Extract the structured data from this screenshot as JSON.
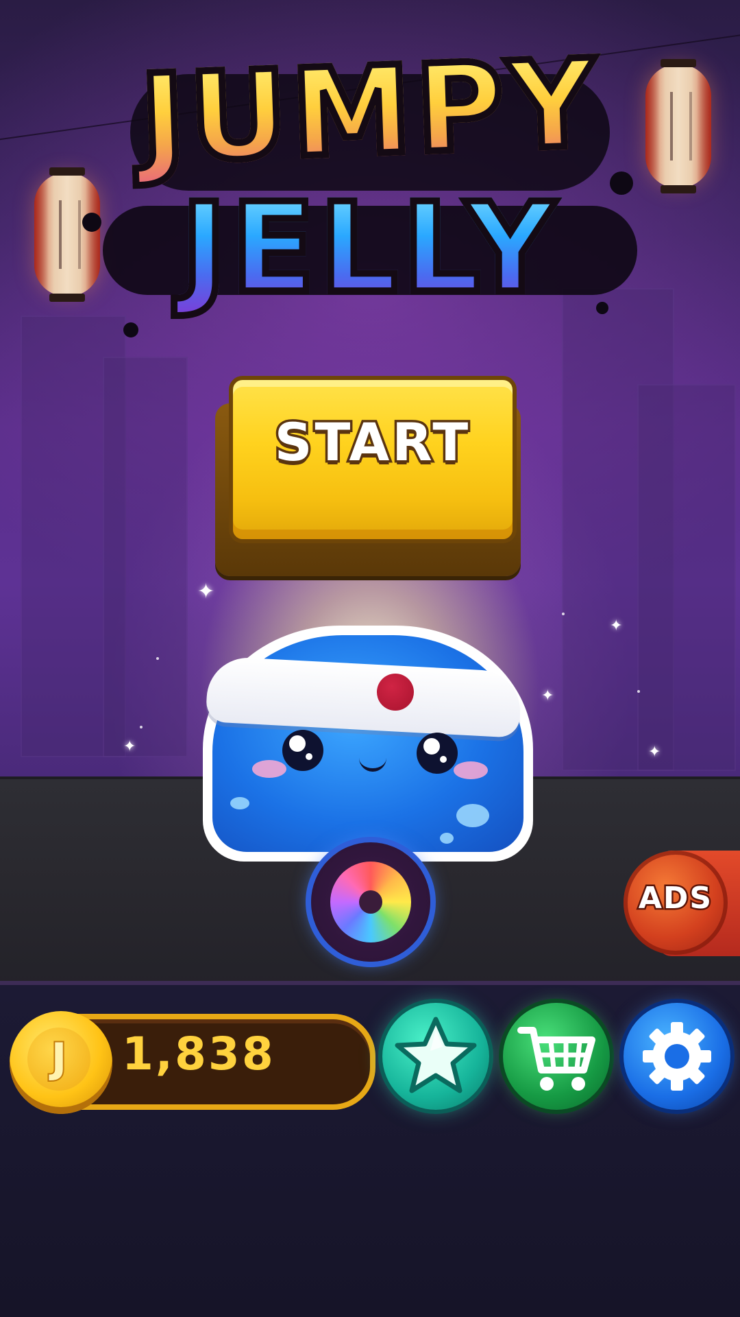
{
  "title": {
    "line1": "JUMPY",
    "line2": "JELLY"
  },
  "menu": {
    "start_label": "START",
    "ads_label": "ADS"
  },
  "currency": {
    "coin_symbol": "J",
    "amount": "1,838"
  },
  "icons": {
    "star": "star-icon",
    "shop": "shopping-cart-icon",
    "settings": "gear-icon",
    "skins": "color-wheel-icon"
  },
  "colors": {
    "start_button": "#ffd21e",
    "ads_button": "#d3401e",
    "star_button": "#16b49a",
    "shop_button": "#169a44",
    "settings_button": "#1a6ee6",
    "coin_text": "#ffd23e"
  }
}
